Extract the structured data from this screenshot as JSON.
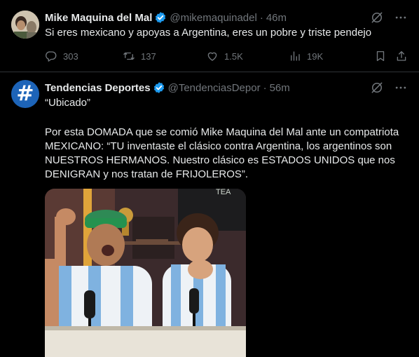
{
  "tweets": [
    {
      "name": "Mike Maquina del Mal",
      "handle": "@mikemaquinadel",
      "separator": "·",
      "time": "46m",
      "text": "Si eres mexicano y apoyas a Argentina, eres un pobre y triste pendejo",
      "replies": "303",
      "retweets": "137",
      "likes": "1.5K",
      "views": "19K"
    },
    {
      "name": "Tendencias Deportes",
      "handle": "@TendenciasDepor",
      "separator": "·",
      "time": "56m",
      "avatar_glyph": "#",
      "quote_line": "“Ubicado”",
      "body": "Por esta DOMADA que se comió Mike Maquina del Mal ante un compatriota MEXICANO: “TU inventaste el clásico contra Argentina, los argentinos son NUESTROS HERMANOS. Nuestro clásico es ESTADOS UNIDOS que nos DENIGRAN y nos tratan de FRIJOLEROS”.",
      "media_sign": "TEA"
    }
  ],
  "colors": {
    "background": "#000000",
    "text": "#e7e9ea",
    "muted": "#71767b",
    "verified": "#1d9bf0",
    "divider": "#2f3336"
  },
  "icons": [
    "verified-badge-icon",
    "grok-icon",
    "more-icon",
    "reply-icon",
    "retweet-icon",
    "like-icon",
    "views-icon",
    "bookmark-icon",
    "share-icon"
  ]
}
